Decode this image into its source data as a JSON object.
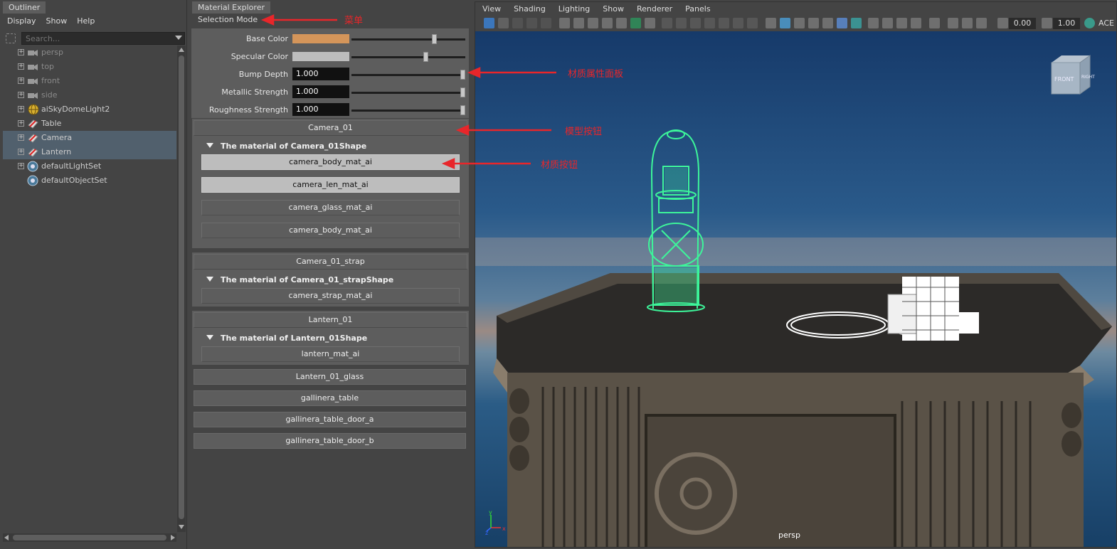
{
  "outliner": {
    "tab": "Outliner",
    "menu": [
      "Display",
      "Show",
      "Help"
    ],
    "search_placeholder": "Search...",
    "items": [
      {
        "label": "persp",
        "icon": "camera-icon",
        "expandable": true,
        "dim": true,
        "selected": false
      },
      {
        "label": "top",
        "icon": "camera-icon",
        "expandable": true,
        "dim": true,
        "selected": false
      },
      {
        "label": "front",
        "icon": "camera-icon",
        "expandable": true,
        "dim": true,
        "selected": false
      },
      {
        "label": "side",
        "icon": "camera-icon",
        "expandable": true,
        "dim": true,
        "selected": false
      },
      {
        "label": "aiSkyDomeLight2",
        "icon": "sky-dome-light-icon",
        "expandable": true,
        "dim": false,
        "selected": false
      },
      {
        "label": "Table",
        "icon": "mesh-icon",
        "expandable": true,
        "dim": false,
        "selected": false
      },
      {
        "label": "Camera",
        "icon": "mesh-icon",
        "expandable": true,
        "dim": false,
        "selected": true
      },
      {
        "label": "Lantern",
        "icon": "mesh-icon",
        "expandable": true,
        "dim": false,
        "selected": true
      },
      {
        "label": "defaultLightSet",
        "icon": "set-icon",
        "expandable": true,
        "dim": false,
        "selected": false
      },
      {
        "label": "defaultObjectSet",
        "icon": "set-icon",
        "expandable": false,
        "dim": false,
        "selected": false
      }
    ]
  },
  "material_explorer": {
    "tab": "Material Explorer",
    "menu": "Selection Mode",
    "attributes": [
      {
        "label": "Base Color",
        "kind": "color",
        "color": "#d4955a",
        "slider": 0.74
      },
      {
        "label": "Specular Color",
        "kind": "color",
        "color": "#bdbdbd",
        "slider": 0.66
      },
      {
        "label": "Bump Depth",
        "kind": "value",
        "value": "1.000",
        "slider": 1.0
      },
      {
        "label": "Metallic Strength",
        "kind": "value",
        "value": "1.000",
        "slider": 1.0
      },
      {
        "label": "Roughness Strength",
        "kind": "value",
        "value": "1.000",
        "slider": 1.0
      }
    ],
    "groups": [
      {
        "model": "Camera_01",
        "material_of": "The material of Camera_01Shape",
        "materials": [
          {
            "label": "camera_body_mat_ai",
            "style": "light"
          },
          {
            "label": "camera_len_mat_ai",
            "style": "light"
          },
          {
            "label": "camera_glass_mat_ai",
            "style": "dark"
          },
          {
            "label": "camera_body_mat_ai",
            "style": "dark"
          }
        ]
      },
      {
        "model": "Camera_01_strap",
        "material_of": "The material of Camera_01_strapShape",
        "materials": [
          {
            "label": "camera_strap_mat_ai",
            "style": "dark"
          }
        ]
      },
      {
        "model": "Lantern_01",
        "material_of": "The material of Lantern_01Shape",
        "materials": [
          {
            "label": "lantern_mat_ai",
            "style": "dark"
          }
        ]
      }
    ],
    "collapsed_models": [
      "Lantern_01_glass",
      "gallinera_table",
      "gallinera_table_door_a",
      "gallinera_table_door_b"
    ]
  },
  "annotations": {
    "menu": "菜单",
    "attr_panel": "材质属性面板",
    "model_button": "模型按钮",
    "material_button": "材质按钮",
    "arrow_color": "#e8262a"
  },
  "viewport": {
    "menu": [
      "View",
      "Shading",
      "Lighting",
      "Show",
      "Renderer",
      "Panels"
    ],
    "exposure": "0.00",
    "gamma": "1.00",
    "color_space": "ACE",
    "camera_name": "persp",
    "viewcube_front": "FRONT",
    "viewcube_right": "RIGHT",
    "axis_x": "x",
    "axis_y": "y",
    "axis_z": "z",
    "wireframe_color": "#3df59a"
  }
}
